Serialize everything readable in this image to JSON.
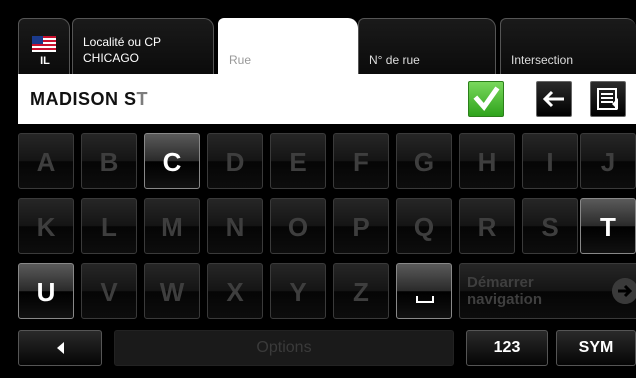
{
  "tabs": {
    "state": "IL",
    "locality_label": "Localité ou CP",
    "locality_value": "CHICAGO",
    "street_label": "Rue",
    "number_label": "N° de rue",
    "intersection_label": "Intersection"
  },
  "input": {
    "value": "MADISON S",
    "cursor": "T"
  },
  "keys": {
    "row1": [
      "A",
      "B",
      "C",
      "D",
      "E",
      "F",
      "G",
      "H",
      "I",
      "J"
    ],
    "row2": [
      "K",
      "L",
      "M",
      "N",
      "O",
      "P",
      "Q",
      "R",
      "S",
      "T"
    ],
    "row3": [
      "U",
      "V",
      "W",
      "X",
      "Y",
      "Z"
    ],
    "start_line1": "Démarrer",
    "start_line2": "navigation"
  },
  "bottom": {
    "options_label": "Options",
    "num_label": "123",
    "sym_label": "SYM"
  },
  "colors": {
    "ok_green": "#3fb52a",
    "active_key": "#ffffff",
    "inactive_key": "#3e3e3e"
  },
  "icons": {
    "flag": "us-flag-icon",
    "ok": "checkmark-icon",
    "back": "backspace-arrow-icon",
    "list": "list-icon",
    "start": "arrow-right-circle-icon",
    "space": "space-icon",
    "left": "triangle-left-icon"
  }
}
